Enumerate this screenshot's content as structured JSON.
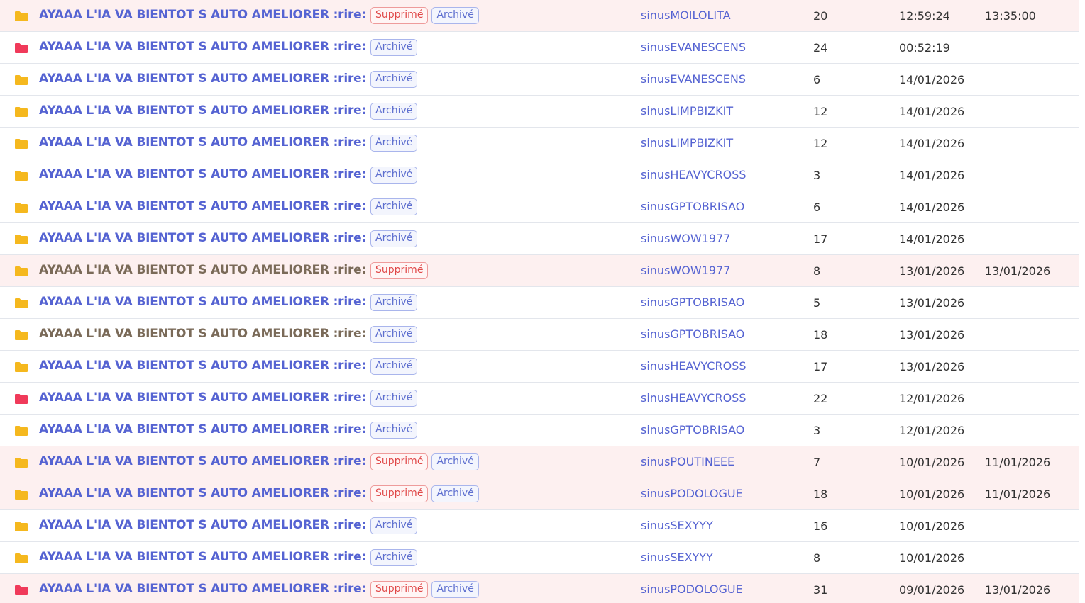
{
  "colors": {
    "link": "#5563d2",
    "visited": "#7a6a58",
    "folder_yellow": "#f5b81e",
    "folder_red": "#f03a5a",
    "deleted_row_bg": "#fdf0f0"
  },
  "badges": {
    "deleted": "Supprimé",
    "archived": "Archivé"
  },
  "topics": [
    {
      "title": "AYAAA L'IA VA BIENTOT S AUTO AMELIORER :rire:",
      "folder": "yellow-folder-icon",
      "visited": false,
      "deleted": true,
      "archived": true,
      "author": "sinusMOILOLITA",
      "replies": "20",
      "date": "12:59:24",
      "deleted_date": "13:35:00"
    },
    {
      "title": "AYAAA L'IA VA BIENTOT S AUTO AMELIORER :rire:",
      "folder": "red-folder-icon",
      "visited": false,
      "deleted": false,
      "archived": true,
      "author": "sinusEVANESCENS",
      "replies": "24",
      "date": "00:52:19",
      "deleted_date": ""
    },
    {
      "title": "AYAAA L'IA VA BIENTOT S AUTO AMELIORER :rire:",
      "folder": "yellow-folder-icon",
      "visited": false,
      "deleted": false,
      "archived": true,
      "author": "sinusEVANESCENS",
      "replies": "6",
      "date": "14/01/2026",
      "deleted_date": ""
    },
    {
      "title": "AYAAA L'IA VA BIENTOT S AUTO AMELIORER :rire:",
      "folder": "yellow-folder-icon",
      "visited": false,
      "deleted": false,
      "archived": true,
      "author": "sinusLIMPBIZKIT",
      "replies": "12",
      "date": "14/01/2026",
      "deleted_date": ""
    },
    {
      "title": "AYAAA L'IA VA BIENTOT S AUTO AMELIORER :rire:",
      "folder": "yellow-folder-icon",
      "visited": false,
      "deleted": false,
      "archived": true,
      "author": "sinusLIMPBIZKIT",
      "replies": "12",
      "date": "14/01/2026",
      "deleted_date": ""
    },
    {
      "title": "AYAAA L'IA VA BIENTOT S AUTO AMELIORER :rire:",
      "folder": "yellow-folder-icon",
      "visited": false,
      "deleted": false,
      "archived": true,
      "author": "sinusHEAVYCROSS",
      "replies": "3",
      "date": "14/01/2026",
      "deleted_date": ""
    },
    {
      "title": "AYAAA L'IA VA BIENTOT S AUTO AMELIORER :rire:",
      "folder": "yellow-folder-icon",
      "visited": false,
      "deleted": false,
      "archived": true,
      "author": "sinusGPTOBRISAO",
      "replies": "6",
      "date": "14/01/2026",
      "deleted_date": ""
    },
    {
      "title": "AYAAA L'IA VA BIENTOT S AUTO AMELIORER :rire:",
      "folder": "yellow-folder-icon",
      "visited": false,
      "deleted": false,
      "archived": true,
      "author": "sinusWOW1977",
      "replies": "17",
      "date": "14/01/2026",
      "deleted_date": ""
    },
    {
      "title": "AYAAA L'IA VA BIENTOT S AUTO AMELIORER :rire:",
      "folder": "yellow-folder-icon",
      "visited": true,
      "deleted": true,
      "archived": false,
      "author": "sinusWOW1977",
      "replies": "8",
      "date": "13/01/2026",
      "deleted_date": "13/01/2026"
    },
    {
      "title": "AYAAA L'IA VA BIENTOT S AUTO AMELIORER :rire:",
      "folder": "yellow-folder-icon",
      "visited": false,
      "deleted": false,
      "archived": true,
      "author": "sinusGPTOBRISAO",
      "replies": "5",
      "date": "13/01/2026",
      "deleted_date": ""
    },
    {
      "title": "AYAAA L'IA VA BIENTOT S AUTO AMELIORER :rire:",
      "folder": "yellow-folder-icon",
      "visited": true,
      "deleted": false,
      "archived": true,
      "author": "sinusGPTOBRISAO",
      "replies": "18",
      "date": "13/01/2026",
      "deleted_date": ""
    },
    {
      "title": "AYAAA L'IA VA BIENTOT S AUTO AMELIORER :rire:",
      "folder": "yellow-folder-icon",
      "visited": false,
      "deleted": false,
      "archived": true,
      "author": "sinusHEAVYCROSS",
      "replies": "17",
      "date": "13/01/2026",
      "deleted_date": ""
    },
    {
      "title": "AYAAA L'IA VA BIENTOT S AUTO AMELIORER :rire:",
      "folder": "red-folder-icon",
      "visited": false,
      "deleted": false,
      "archived": true,
      "author": "sinusHEAVYCROSS",
      "replies": "22",
      "date": "12/01/2026",
      "deleted_date": ""
    },
    {
      "title": "AYAAA L'IA VA BIENTOT S AUTO AMELIORER :rire:",
      "folder": "yellow-folder-icon",
      "visited": false,
      "deleted": false,
      "archived": true,
      "author": "sinusGPTOBRISAO",
      "replies": "3",
      "date": "12/01/2026",
      "deleted_date": ""
    },
    {
      "title": "AYAAA L'IA VA BIENTOT S AUTO AMELIORER :rire:",
      "folder": "yellow-folder-icon",
      "visited": false,
      "deleted": true,
      "archived": true,
      "author": "sinusPOUTINEEE",
      "replies": "7",
      "date": "10/01/2026",
      "deleted_date": "11/01/2026"
    },
    {
      "title": "AYAAA L'IA VA BIENTOT S AUTO AMELIORER :rire:",
      "folder": "yellow-folder-icon",
      "visited": false,
      "deleted": true,
      "archived": true,
      "author": "sinusPODOLOGUE",
      "replies": "18",
      "date": "10/01/2026",
      "deleted_date": "11/01/2026"
    },
    {
      "title": "AYAAA L'IA VA BIENTOT S AUTO AMELIORER :rire:",
      "folder": "yellow-folder-icon",
      "visited": false,
      "deleted": false,
      "archived": true,
      "author": "sinusSEXYYY",
      "replies": "16",
      "date": "10/01/2026",
      "deleted_date": ""
    },
    {
      "title": "AYAAA L'IA VA BIENTOT S AUTO AMELIORER :rire:",
      "folder": "yellow-folder-icon",
      "visited": false,
      "deleted": false,
      "archived": true,
      "author": "sinusSEXYYY",
      "replies": "8",
      "date": "10/01/2026",
      "deleted_date": ""
    },
    {
      "title": "AYAAA L'IA VA BIENTOT S AUTO AMELIORER :rire:",
      "folder": "red-folder-icon",
      "visited": false,
      "deleted": true,
      "archived": true,
      "author": "sinusPODOLOGUE",
      "replies": "31",
      "date": "09/01/2026",
      "deleted_date": "13/01/2026"
    }
  ]
}
